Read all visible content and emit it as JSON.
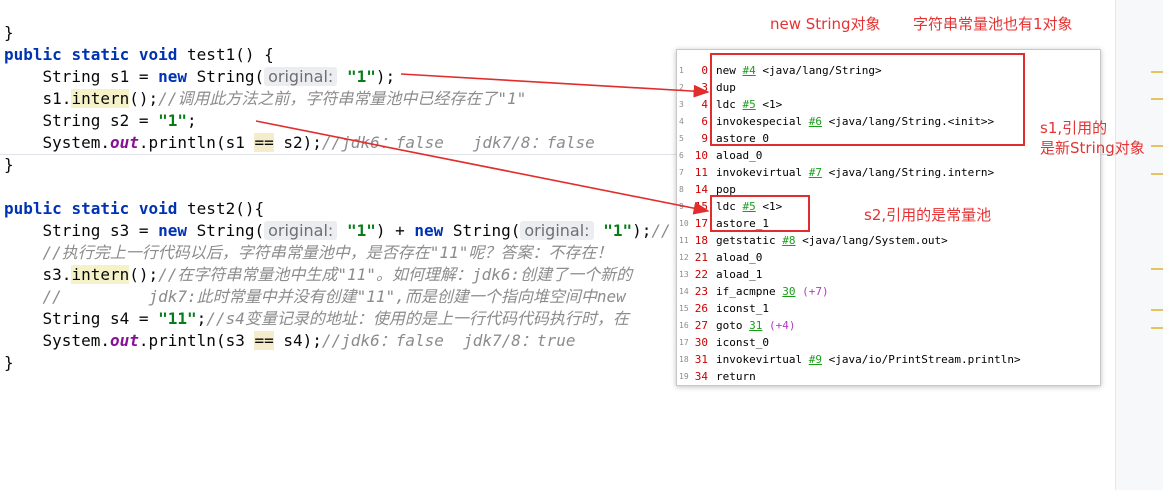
{
  "code": {
    "brace_close_top": "}",
    "test1_sig": [
      "public",
      "static",
      "void",
      " test1() {"
    ],
    "s1_decl": {
      "type": "String s1 = ",
      "kw": "new",
      "cls": " String(",
      "hint": "original:",
      "str": "\"1\"",
      "end": ");"
    },
    "s1_intern": {
      "pre": "s1.",
      "method": "intern",
      "post": "();",
      "comment": "//调用此方法之前，字符串常量池中已经存在了\"1\""
    },
    "s2_decl": {
      "type": "String s2 = ",
      "str": "\"1\"",
      "end": ";"
    },
    "print1": {
      "pre": "System.",
      "field": "out",
      "mid": ".println(s1 ",
      "op": "==",
      "post": " s2);",
      "comment": "//jdk6：false   jdk7/8：false"
    },
    "brace_close_1": "}",
    "test2_sig": [
      "public",
      "static",
      "void",
      " test2(){"
    ],
    "s3_decl": {
      "type": "String s3 = ",
      "kw1": "new",
      "cls1": " String(",
      "hint1": "original:",
      "str1": "\"1\"",
      "plus": ") + ",
      "kw2": "new",
      "cls2": " String(",
      "hint2": "original:",
      "str2": "\"1\"",
      "end": ");",
      "comment": "//"
    },
    "comment_line": "//执行完上一行代码以后，字符串常量池中，是否存在\"11\"呢？答案：不存在！",
    "s3_intern": {
      "pre": "s3.",
      "method": "intern",
      "post": "();",
      "comment": "//在字符串常量池中生成\"11\"。如何理解：jdk6:创建了一个新的"
    },
    "jdk7_comment": "//         jdk7:此时常量中并没有创建\"11\",而是创建一个指向堆空间中new",
    "s4_decl": {
      "type": "String s4 = ",
      "str": "\"11\"",
      "end": ";",
      "comment": "//s4变量记录的地址：使用的是上一行代码代码执行时，在"
    },
    "print2": {
      "pre": "System.",
      "field": "out",
      "mid": ".println(s3 ",
      "op": "==",
      "post": " s4);",
      "comment": "//jdk6：false  jdk7/8：true"
    },
    "brace_close_2": "}"
  },
  "bytecode": [
    {
      "line": "1",
      "offset": "0",
      "op": "new ",
      "ref": "#4",
      "arg": " <java/lang/String>"
    },
    {
      "line": "2",
      "offset": "3",
      "op": "dup",
      "ref": "",
      "arg": ""
    },
    {
      "line": "3",
      "offset": "4",
      "op": "ldc ",
      "ref": "#5",
      "arg": " <1>"
    },
    {
      "line": "4",
      "offset": "6",
      "op": "invokespecial ",
      "ref": "#6",
      "arg": " <java/lang/String.<init>>"
    },
    {
      "line": "5",
      "offset": "9",
      "op": "astore_0",
      "ref": "",
      "arg": ""
    },
    {
      "line": "6",
      "offset": "10",
      "op": "aload_0",
      "ref": "",
      "arg": ""
    },
    {
      "line": "7",
      "offset": "11",
      "op": "invokevirtual ",
      "ref": "#7",
      "arg": " <java/lang/String.intern>"
    },
    {
      "line": "8",
      "offset": "14",
      "op": "pop",
      "ref": "",
      "arg": ""
    },
    {
      "line": "9",
      "offset": "15",
      "op": "ldc ",
      "ref": "#5",
      "arg": " <1>"
    },
    {
      "line": "10",
      "offset": "17",
      "op": "astore_1",
      "ref": "",
      "arg": ""
    },
    {
      "line": "11",
      "offset": "18",
      "op": "getstatic ",
      "ref": "#8",
      "arg": " <java/lang/System.out>"
    },
    {
      "line": "12",
      "offset": "21",
      "op": "aload_0",
      "ref": "",
      "arg": ""
    },
    {
      "line": "13",
      "offset": "22",
      "op": "aload_1",
      "ref": "",
      "arg": ""
    },
    {
      "line": "14",
      "offset": "23",
      "op": "if_acmpne ",
      "ref": "30",
      "arg": " (+7)"
    },
    {
      "line": "15",
      "offset": "26",
      "op": "iconst_1",
      "ref": "",
      "arg": ""
    },
    {
      "line": "16",
      "offset": "27",
      "op": "goto ",
      "ref": "31",
      "arg": " (+4)"
    },
    {
      "line": "17",
      "offset": "30",
      "op": "iconst_0",
      "ref": "",
      "arg": ""
    },
    {
      "line": "18",
      "offset": "31",
      "op": "invokevirtual ",
      "ref": "#9",
      "arg": " <java/io/PrintStream.println>"
    },
    {
      "line": "19",
      "offset": "34",
      "op": "return",
      "ref": "",
      "arg": ""
    }
  ],
  "annotations": {
    "top_left": "new String对象",
    "top_right": "字符串常量池也有1对象",
    "s1_note": "s1,引用的\n是新String对象",
    "s2_note": "s2,引用的是常量池"
  },
  "colors": {
    "annotation_red": "#e63232",
    "keyword": "#0033b3",
    "string": "#067d17",
    "comment": "#8c8c8c",
    "bytecode_offset": "#cc0000",
    "bytecode_ref": "#1a9e1a",
    "bytecode_jump": "#b03cc2"
  }
}
